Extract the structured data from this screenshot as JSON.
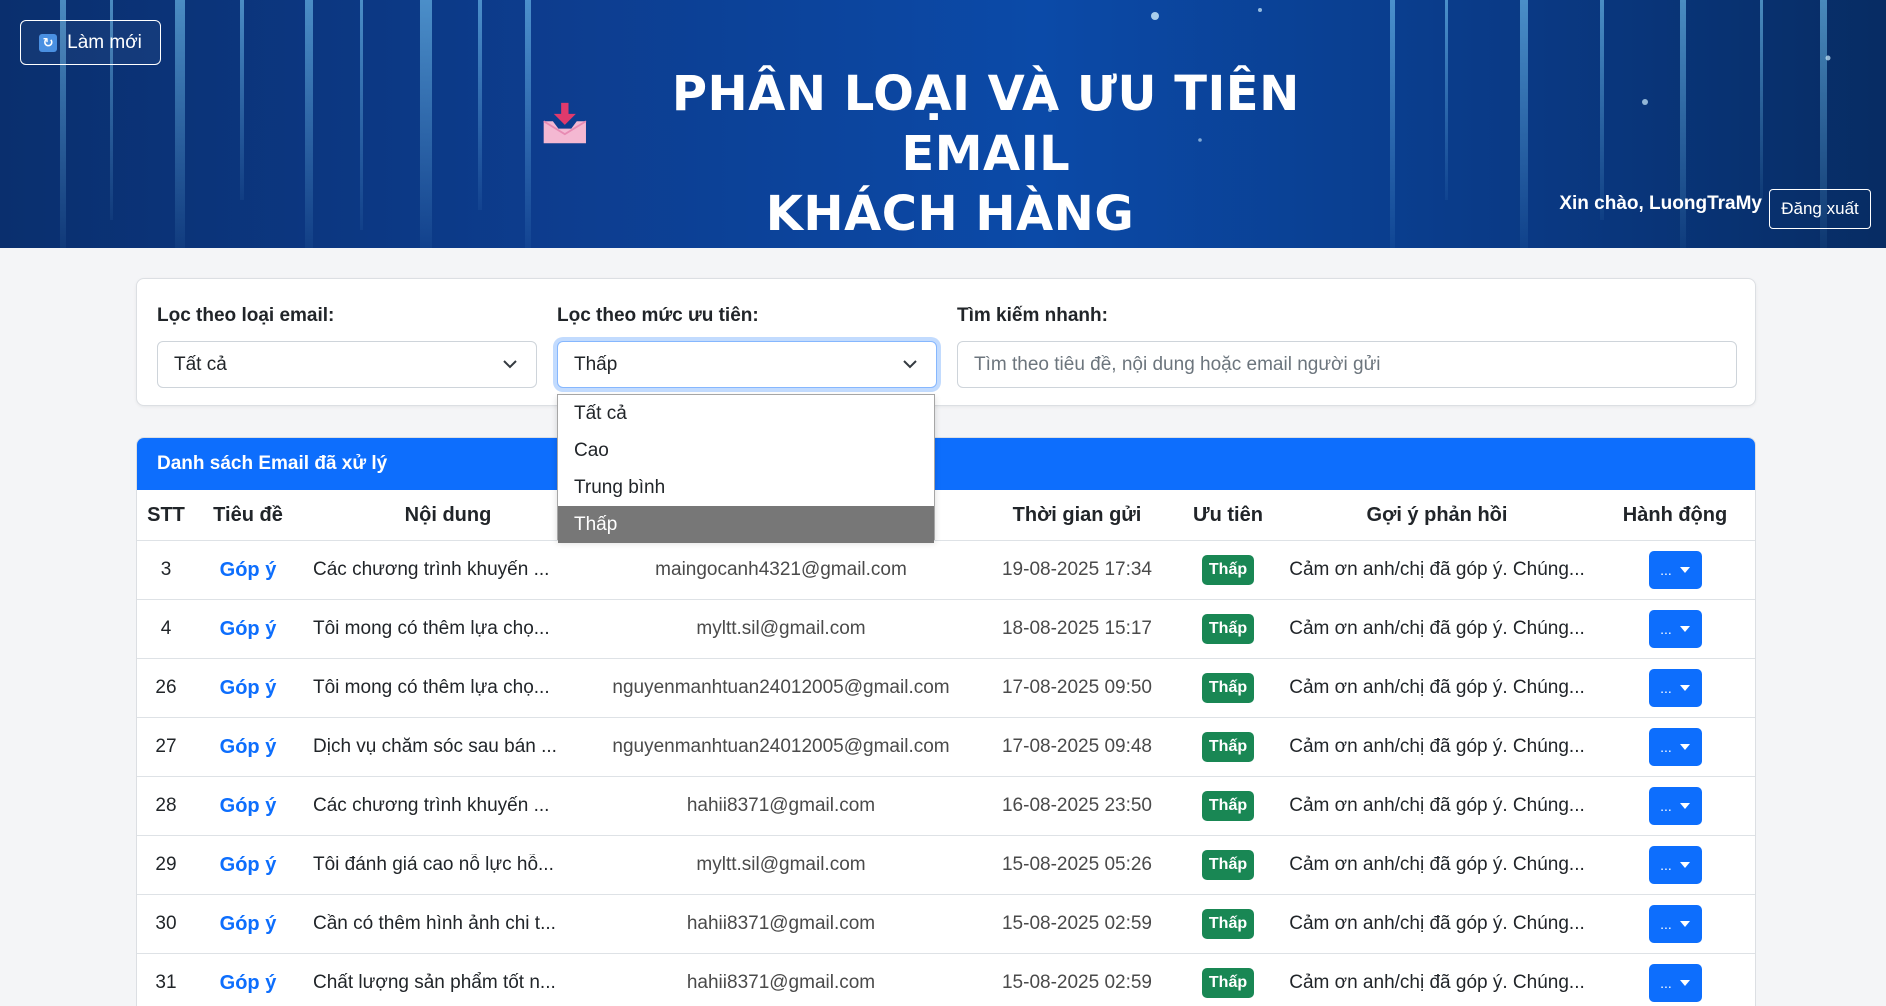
{
  "header": {
    "refresh_label": "Làm mới",
    "title_line1": "PHÂN LOẠI VÀ ƯU TIÊN EMAIL",
    "title_line2": "KHÁCH HÀNG",
    "greeting": "Xin chào, LuongTraMy",
    "logout_label": "Đăng xuất"
  },
  "filters": {
    "type_label": "Lọc theo loại email:",
    "type_value": "Tất cả",
    "priority_label": "Lọc theo mức ưu tiên:",
    "priority_value": "Thấp",
    "priority_options": [
      "Tất cả",
      "Cao",
      "Trung bình",
      "Thấp"
    ],
    "priority_selected_index": 3,
    "search_label": "Tìm kiếm nhanh:",
    "search_placeholder": "Tìm theo tiêu đề, nội dung hoặc email người gửi"
  },
  "table": {
    "heading": "Danh sách Email đã xử lý",
    "columns": [
      "STT",
      "Tiêu đề",
      "Nội dung",
      "",
      "Thời gian gửi",
      "Ưu tiên",
      "Gợi ý phản hồi",
      "Hành động"
    ],
    "action_label": "...",
    "rows": [
      {
        "stt": "3",
        "title": "Góp ý",
        "content": "Các chương trình khuyến ...",
        "email": "maingocanh4321@gmail.com",
        "time": "19-08-2025 17:34",
        "priority": "Thấp",
        "reply": "Cảm ơn anh/chị đã góp ý. Chúng..."
      },
      {
        "stt": "4",
        "title": "Góp ý",
        "content": "Tôi mong có thêm lựa chọ...",
        "email": "myltt.sil@gmail.com",
        "time": "18-08-2025 15:17",
        "priority": "Thấp",
        "reply": "Cảm ơn anh/chị đã góp ý. Chúng..."
      },
      {
        "stt": "26",
        "title": "Góp ý",
        "content": "Tôi mong có thêm lựa chọ...",
        "email": "nguyenmanhtuan24012005@gmail.com",
        "time": "17-08-2025 09:50",
        "priority": "Thấp",
        "reply": "Cảm ơn anh/chị đã góp ý. Chúng..."
      },
      {
        "stt": "27",
        "title": "Góp ý",
        "content": "Dịch vụ chăm sóc sau bán ...",
        "email": "nguyenmanhtuan24012005@gmail.com",
        "time": "17-08-2025 09:48",
        "priority": "Thấp",
        "reply": "Cảm ơn anh/chị đã góp ý. Chúng..."
      },
      {
        "stt": "28",
        "title": "Góp ý",
        "content": "Các chương trình khuyến ...",
        "email": "hahii8371@gmail.com",
        "time": "16-08-2025 23:50",
        "priority": "Thấp",
        "reply": "Cảm ơn anh/chị đã góp ý. Chúng..."
      },
      {
        "stt": "29",
        "title": "Góp ý",
        "content": "Tôi đánh giá cao nỗ lực hỗ...",
        "email": "myltt.sil@gmail.com",
        "time": "15-08-2025 05:26",
        "priority": "Thấp",
        "reply": "Cảm ơn anh/chị đã góp ý. Chúng..."
      },
      {
        "stt": "30",
        "title": "Góp ý",
        "content": "Cần có thêm hình ảnh chi t...",
        "email": "hahii8371@gmail.com",
        "time": "15-08-2025 02:59",
        "priority": "Thấp",
        "reply": "Cảm ơn anh/chị đã góp ý. Chúng..."
      },
      {
        "stt": "31",
        "title": "Góp ý",
        "content": "Chất lượng sản phẩm tốt n...",
        "email": "hahii8371@gmail.com",
        "time": "15-08-2025 02:59",
        "priority": "Thấp",
        "reply": "Cảm ơn anh/chị đã góp ý. Chúng..."
      }
    ]
  },
  "colors": {
    "primary": "#0d6efd",
    "badge_low": "#198754",
    "header_bg": "#0b3f8f"
  },
  "icons": {
    "refresh": "refresh-icon",
    "inbox": "inbox-download-icon",
    "chevron": "chevron-down-icon",
    "caret": "caret-down-icon"
  }
}
